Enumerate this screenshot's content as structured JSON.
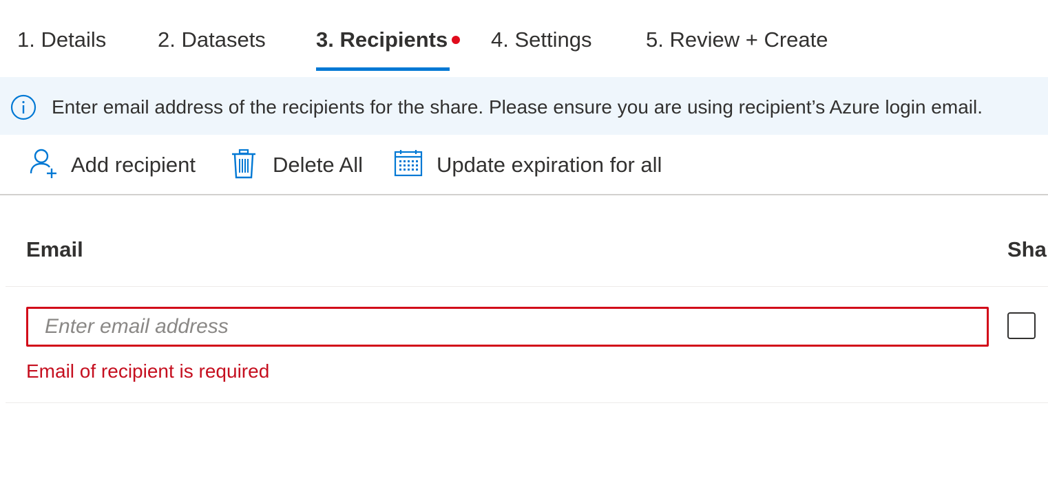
{
  "tabs": [
    {
      "label": "1. Details"
    },
    {
      "label": "2. Datasets"
    },
    {
      "label": "3. Recipients",
      "active": true,
      "has_error": true
    },
    {
      "label": "4. Settings"
    },
    {
      "label": "5. Review + Create"
    }
  ],
  "info_banner": {
    "icon": "info-icon",
    "text": "Enter email address of the recipients for the share. Please ensure you are using recipient’s Azure login email."
  },
  "toolbar": {
    "add_recipient": {
      "label": "Add recipient",
      "icon": "add-user-icon"
    },
    "delete_all": {
      "label": "Delete All",
      "icon": "trash-icon"
    },
    "update_expiration": {
      "label": "Update expiration for all",
      "icon": "calendar-icon"
    }
  },
  "table": {
    "columns": [
      "Email",
      "Shar"
    ],
    "rows": [
      {
        "email": {
          "value": "",
          "placeholder": "Enter email address",
          "required_marker": "*",
          "error": "Email of recipient is required"
        },
        "share_checked": false
      }
    ]
  },
  "colors": {
    "accent": "#0078d4",
    "error": "#d20a19",
    "banner_bg": "#eff6fc"
  }
}
